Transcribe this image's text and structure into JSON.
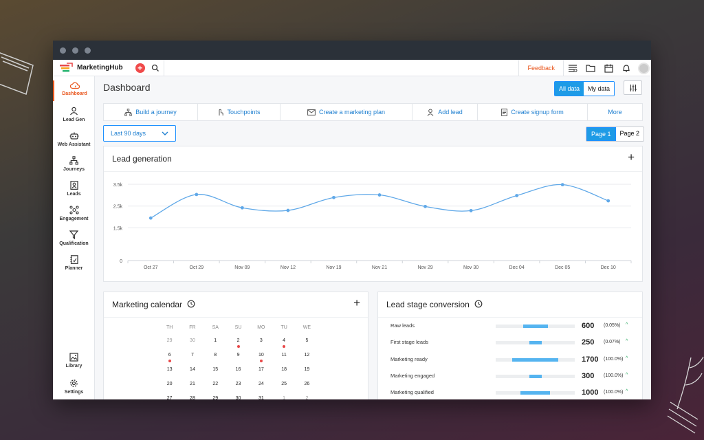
{
  "app": {
    "name": "MarketingHub",
    "feedback_label": "Feedback"
  },
  "sidebar": {
    "items": [
      {
        "label": "Dashboard",
        "icon": "cloud-gauge-icon",
        "active": true
      },
      {
        "label": "Lead Gen",
        "icon": "user-chart-icon"
      },
      {
        "label": "Web Assistant",
        "icon": "robot-icon"
      },
      {
        "label": "Journeys",
        "icon": "flow-tree-icon"
      },
      {
        "label": "Leads",
        "icon": "contact-card-icon"
      },
      {
        "label": "Engagement",
        "icon": "people-network-icon"
      },
      {
        "label": "Qualification",
        "icon": "funnel-icon"
      },
      {
        "label": "Planner",
        "icon": "planner-book-icon"
      },
      {
        "label": "Library",
        "icon": "image-library-icon"
      },
      {
        "label": "Settings",
        "icon": "gear-icon"
      }
    ]
  },
  "header": {
    "title": "Dashboard",
    "scope_toggle": {
      "all": "All data",
      "mine": "My data",
      "selected": "All data"
    }
  },
  "actions": [
    {
      "label": "Build a journey",
      "icon": "flow-tree-icon"
    },
    {
      "label": "Touchpoints",
      "icon": "touch-icon"
    },
    {
      "label": "Create a marketing plan",
      "icon": "mail-icon"
    },
    {
      "label": "Add lead",
      "icon": "add-user-icon"
    },
    {
      "label": "Create signup form",
      "icon": "form-icon"
    },
    {
      "label": "More",
      "icon": ""
    }
  ],
  "filters": {
    "date_range": "Last 90 days",
    "pages": [
      "Page 1",
      "Page 2"
    ],
    "current_page": "Page 1"
  },
  "lead_generation": {
    "title": "Lead generation",
    "add_label": "+"
  },
  "chart_data": {
    "type": "line",
    "title": "Lead generation",
    "categories": [
      "Oct 27",
      "Oct 29",
      "Nov 09",
      "Nov 12",
      "Nov 19",
      "Nov 21",
      "Nov 29",
      "Nov 30",
      "Dec 04",
      "Dec 05",
      "Dec 10"
    ],
    "values": [
      1950,
      3030,
      2420,
      2300,
      2890,
      3010,
      2480,
      2290,
      2980,
      3480,
      2740
    ],
    "y_ticks": [
      "0",
      "1.5k",
      "2.5k",
      "3.5k"
    ],
    "ylim": [
      0,
      3500
    ],
    "grid": true,
    "color": "#5fa8e8"
  },
  "marketing_calendar": {
    "title": "Marketing calendar",
    "add_label": "+",
    "weekdays": [
      "TH",
      "FR",
      "SA",
      "SU",
      "MO",
      "TU",
      "WE"
    ],
    "weeks": [
      [
        {
          "d": "29",
          "m": true
        },
        {
          "d": "30",
          "m": true
        },
        {
          "d": "1"
        },
        {
          "d": "2",
          "e": true
        },
        {
          "d": "3"
        },
        {
          "d": "4",
          "e": true
        },
        {
          "d": "5"
        }
      ],
      [
        {
          "d": "6",
          "e": true
        },
        {
          "d": "7"
        },
        {
          "d": "8"
        },
        {
          "d": "9"
        },
        {
          "d": "10",
          "e": true
        },
        {
          "d": "11"
        },
        {
          "d": "12"
        }
      ],
      [
        {
          "d": "13"
        },
        {
          "d": "14"
        },
        {
          "d": "15"
        },
        {
          "d": "16"
        },
        {
          "d": "17"
        },
        {
          "d": "18"
        },
        {
          "d": "19"
        }
      ],
      [
        {
          "d": "20"
        },
        {
          "d": "21"
        },
        {
          "d": "22"
        },
        {
          "d": "23"
        },
        {
          "d": "24"
        },
        {
          "d": "25"
        },
        {
          "d": "26"
        }
      ],
      [
        {
          "d": "27"
        },
        {
          "d": "28"
        },
        {
          "d": "29"
        },
        {
          "d": "30"
        },
        {
          "d": "31"
        },
        {
          "d": "1",
          "m": true
        },
        {
          "d": "2",
          "m": true
        }
      ]
    ]
  },
  "lead_stage_conversion": {
    "title": "Lead stage conversion",
    "stages": [
      {
        "label": "Raw leads",
        "value": "600",
        "pct": "(0.05%)",
        "bar_start": 0.35,
        "bar_fraction": 0.31
      },
      {
        "label": "First stage leads",
        "value": "250",
        "pct": "(0.07%)",
        "bar_start": 0.43,
        "bar_fraction": 0.15
      },
      {
        "label": "Marketing ready",
        "value": "1700",
        "pct": "(100.0%)",
        "bar_start": 0.21,
        "bar_fraction": 0.58
      },
      {
        "label": "Marketing engaged",
        "value": "300",
        "pct": "(100.0%)",
        "bar_start": 0.43,
        "bar_fraction": 0.15
      },
      {
        "label": "Marketing qualified",
        "value": "1000",
        "pct": "(100.0%)",
        "bar_start": 0.31,
        "bar_fraction": 0.38
      }
    ],
    "trend_glyph": "^"
  }
}
